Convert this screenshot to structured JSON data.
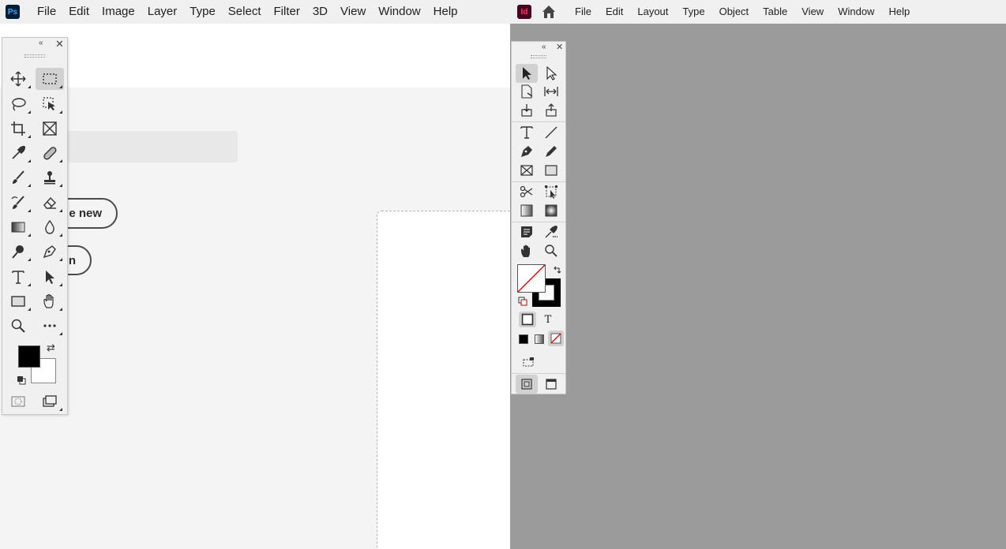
{
  "photoshop": {
    "logo_text": "Ps",
    "menu": [
      "File",
      "Edit",
      "Image",
      "Layer",
      "Type",
      "Select",
      "Filter",
      "3D",
      "View",
      "Window",
      "Help"
    ],
    "home": {
      "create_new_label": "e new",
      "open_label": "n"
    },
    "toolbar": {
      "collapse_glyph": "«",
      "close_glyph": "✕",
      "tools": [
        "move-tool",
        "rectangular-marquee-tool",
        "lasso-tool",
        "object-selection-tool",
        "crop-tool",
        "frame-tool",
        "eyedropper-tool",
        "spot-healing-brush-tool",
        "brush-tool",
        "clone-stamp-tool",
        "history-brush-tool",
        "eraser-tool",
        "gradient-tool",
        "blur-tool",
        "dodge-tool",
        "pen-tool",
        "type-tool",
        "path-selection-tool",
        "rectangle-tool",
        "hand-tool",
        "zoom-tool",
        "edit-toolbar"
      ],
      "selected_tool": "rectangular-marquee-tool",
      "foreground_color": "#000000",
      "background_color": "#ffffff",
      "swap_glyph": "⇄"
    }
  },
  "indesign": {
    "logo_text": "Id",
    "menu": [
      "File",
      "Edit",
      "Layout",
      "Type",
      "Object",
      "Table",
      "View",
      "Window",
      "Help"
    ],
    "toolbar": {
      "collapse_glyph": "«",
      "close_glyph": "✕",
      "tools": [
        "selection-tool",
        "direct-selection-tool",
        "page-tool",
        "gap-tool",
        "content-collector-tool",
        "content-placer-tool",
        "type-tool",
        "line-tool",
        "pen-tool",
        "pencil-tool",
        "rectangle-frame-tool",
        "rectangle-tool",
        "scissors-tool",
        "free-transform-tool",
        "gradient-swatch-tool",
        "gradient-feather-tool",
        "note-tool",
        "color-theme-tool",
        "hand-tool",
        "zoom-tool"
      ],
      "selected_tool": "selection-tool",
      "fill_color": "none",
      "stroke_color": "#000000",
      "formatting_text_glyph": "T"
    }
  }
}
